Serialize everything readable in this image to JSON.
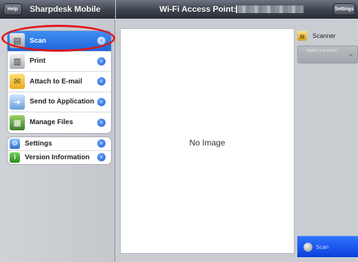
{
  "header": {
    "help_label": "Help",
    "app_title": "Sharpdesk Mobile",
    "access_point_label": "Wi-Fi Access Point:",
    "settings_label": "Settings"
  },
  "sidebar": {
    "main_items": [
      {
        "label": "Scan",
        "icon": "scan-icon",
        "selected": true
      },
      {
        "label": "Print",
        "icon": "print-icon"
      },
      {
        "label": "Attach to E-mail",
        "icon": "mail-icon"
      },
      {
        "label": "Send to Application",
        "icon": "send-app-icon"
      },
      {
        "label": "Manage Files",
        "icon": "files-icon"
      }
    ],
    "info_items": [
      {
        "label": "Settings",
        "icon": "settings-icon"
      },
      {
        "label": "Version Information",
        "icon": "info-icon"
      }
    ]
  },
  "preview": {
    "placeholder": "No Image"
  },
  "scanner_panel": {
    "label": "Scanner",
    "select_text": "Select a scanner",
    "scan_button_label": "Scan"
  },
  "colors": {
    "selected": "#1f66d9",
    "annotation": "#e0161b",
    "scan_button": "#0a3fdc"
  }
}
